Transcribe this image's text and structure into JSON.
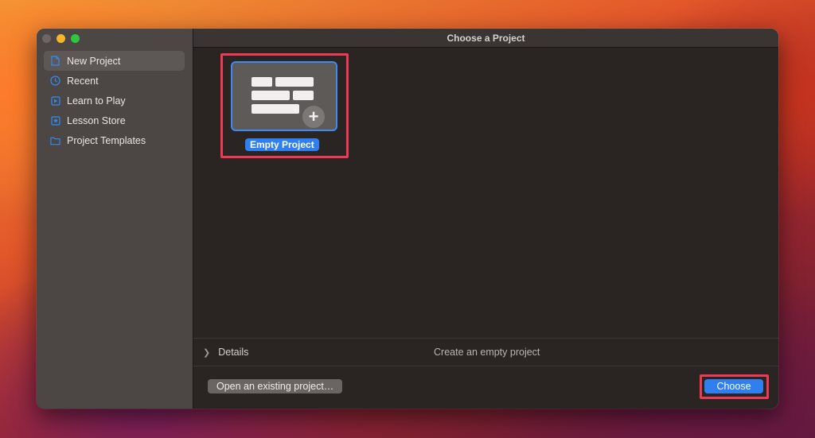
{
  "window": {
    "title": "Choose a Project"
  },
  "sidebar": {
    "items": [
      {
        "label": "New Project",
        "icon": "document-icon",
        "selected": true
      },
      {
        "label": "Recent",
        "icon": "clock-icon",
        "selected": false
      },
      {
        "label": "Learn to Play",
        "icon": "book-icon",
        "selected": false
      },
      {
        "label": "Lesson Store",
        "icon": "star-icon",
        "selected": false
      },
      {
        "label": "Project Templates",
        "icon": "folder-icon",
        "selected": false
      }
    ]
  },
  "templates": [
    {
      "label": "Empty Project",
      "icon": "empty-project-icon",
      "selected": true
    }
  ],
  "details": {
    "label": "Details",
    "description": "Create an empty project"
  },
  "footer": {
    "open_label": "Open an existing project…",
    "choose_label": "Choose"
  },
  "colors": {
    "accent": "#2f7ff0",
    "highlight": "#ef3a55"
  }
}
